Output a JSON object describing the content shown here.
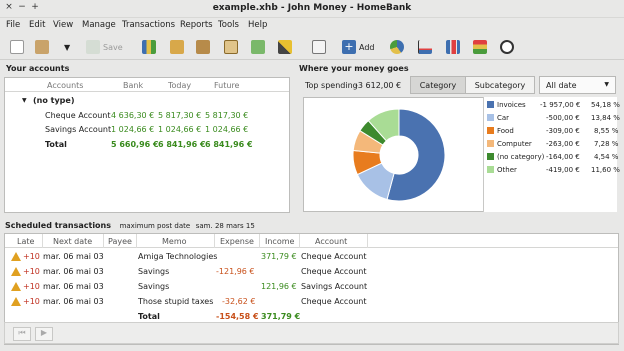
{
  "window": {
    "title": "example.xhb - John Money - HomeBank",
    "close": "×",
    "minimize": "−",
    "maximize": "+"
  },
  "menu": [
    "File",
    "Edit",
    "View",
    "Manage",
    "Transactions",
    "Reports",
    "Tools",
    "Help"
  ],
  "toolbar": {
    "save_label": "Save",
    "add_label": "Add"
  },
  "accounts": {
    "title": "Your accounts",
    "headers": {
      "accounts": "Accounts",
      "bank": "Bank",
      "today": "Today",
      "future": "Future"
    },
    "group": "(no type)",
    "rows": [
      {
        "name": "Cheque Account",
        "bank": "4 636,30 €",
        "today": "5 817,30 €",
        "future": "5 817,30 €"
      },
      {
        "name": "Savings Account",
        "bank": "1 024,66 €",
        "today": "1 024,66 €",
        "future": "1 024,66 €"
      },
      {
        "name": "Total",
        "bank": "5 660,96 €",
        "today": "6 841,96 €",
        "future": "6 841,96 €"
      }
    ]
  },
  "where": {
    "title": "Where your money goes",
    "top_spending_label": "Top spending",
    "top_spending_value": "-3 612,00 €",
    "tab_category": "Category",
    "tab_subcategory": "Subcategory",
    "date_filter": "All date",
    "legend": [
      {
        "name": "Invoices",
        "amount": "-1 957,00 €",
        "percent": "54,18 %",
        "color": "#4a72b0"
      },
      {
        "name": "Car",
        "amount": "-500,00 €",
        "percent": "13,84 %",
        "color": "#a8c1e6"
      },
      {
        "name": "Food",
        "amount": "-309,00 €",
        "percent": "8,55 %",
        "color": "#e87c1e"
      },
      {
        "name": "Computer",
        "amount": "-263,00 €",
        "percent": "7,28 %",
        "color": "#f4b87a"
      },
      {
        "name": "(no category)",
        "amount": "-164,00 €",
        "percent": "4,54 %",
        "color": "#3d8a2e"
      },
      {
        "name": "Other",
        "amount": "-419,00 €",
        "percent": "11,60 %",
        "color": "#a9dc95"
      }
    ]
  },
  "chart_data": {
    "type": "pie",
    "categories": [
      "Invoices",
      "Car",
      "Food",
      "Computer",
      "(no category)",
      "Other"
    ],
    "values": [
      1957,
      500,
      309,
      263,
      164,
      419
    ],
    "colors": [
      "#4a72b0",
      "#a8c1e6",
      "#e87c1e",
      "#f4b87a",
      "#3d8a2e",
      "#a9dc95"
    ]
  },
  "scheduled": {
    "title": "Scheduled transactions",
    "max_post_label": "maximum post date",
    "max_post_value": "sam. 28 mars 15",
    "headers": {
      "late": "Late",
      "next_date": "Next date",
      "payee": "Payee",
      "memo": "Memo",
      "expense": "Expense",
      "income": "Income",
      "account": "Account"
    },
    "rows": [
      {
        "late": "+10",
        "date": "mar. 06 mai 03",
        "payee": "",
        "memo": "Amiga Technologies",
        "expense": "",
        "income": "371,79 €",
        "account": "Cheque Account"
      },
      {
        "late": "+10",
        "date": "mar. 06 mai 03",
        "payee": "",
        "memo": "Savings",
        "expense": "-121,96 €",
        "income": "",
        "account": "Cheque Account"
      },
      {
        "late": "+10",
        "date": "mar. 06 mai 03",
        "payee": "",
        "memo": "Savings",
        "expense": "",
        "income": "121,96 €",
        "account": "Savings Account"
      },
      {
        "late": "+10",
        "date": "mar. 06 mai 03",
        "payee": "",
        "memo": "Those stupid taxes",
        "expense": "-32,62 €",
        "income": "",
        "account": "Cheque Account"
      }
    ],
    "total": {
      "memo": "Total",
      "expense": "-154,58 €",
      "income": "371,79 €"
    }
  }
}
